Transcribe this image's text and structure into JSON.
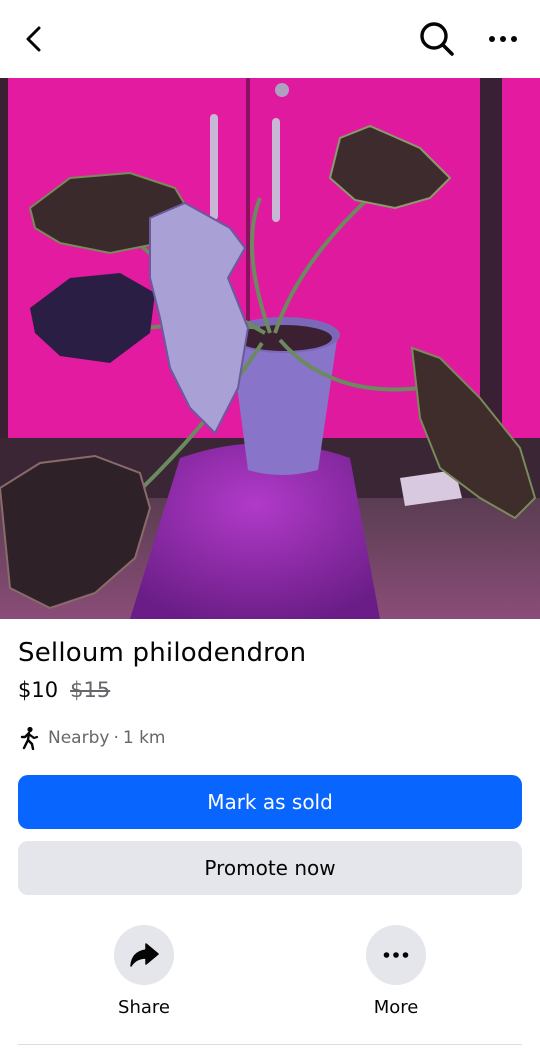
{
  "header": {
    "back_icon": "chevron-left-icon",
    "search_icon": "search-icon",
    "more_icon": "ellipsis-icon"
  },
  "listing": {
    "photo_alt": "Selloum philodendron",
    "title": "Selloum philodendron",
    "price": "$10",
    "original_price": "$15",
    "location_icon": "walking-person-icon",
    "distance_label": "Nearby",
    "separator": "·",
    "distance": "1 km"
  },
  "actions": {
    "mark_sold_label": "Mark as sold",
    "promote_label": "Promote now",
    "share_label": "Share",
    "share_icon": "share-arrow-icon",
    "more_label": "More",
    "more_icon": "ellipsis-icon"
  },
  "colors": {
    "primary": "#0866ff",
    "secondary_bg": "#e4e6eb",
    "muted_text": "#65676b"
  }
}
